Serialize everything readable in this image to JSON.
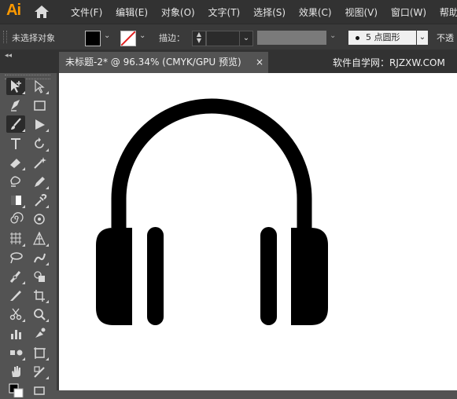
{
  "app": {
    "logo": "Ai"
  },
  "menus": [
    "文件(F)",
    "编辑(E)",
    "对象(O)",
    "文字(T)",
    "选择(S)",
    "效果(C)",
    "视图(V)",
    "窗口(W)",
    "帮助(H)"
  ],
  "control_bar": {
    "selection_label": "未选择对象",
    "stroke_label": "描边：",
    "brush_size": "5",
    "brush_label": "点圆形",
    "opacity_label": "不透"
  },
  "document": {
    "tab_title": "未标题-2* @ 96.34% (CMYK/GPU 预览)",
    "close_glyph": "×",
    "watermark": "软件自学网：RJZXW.COM"
  },
  "colors": {
    "fill": "#000000",
    "stroke": "none",
    "accent": "#ff9a00"
  },
  "tools": [
    [
      "selection-tool",
      "direct-selection-tool"
    ],
    [
      "pen-tool",
      "rectangle-tool"
    ],
    [
      "paintbrush-tool",
      "shaper-tool"
    ],
    [
      "type-tool",
      "rotate-tool"
    ],
    [
      "eraser-tool",
      "magic-wand-tool"
    ],
    [
      "blob-brush-tool",
      "pencil-tool"
    ],
    [
      "gradient-tool",
      "eyedropper-tool"
    ],
    [
      "spiral-tool",
      "symbol-sprayer-tool"
    ],
    [
      "mesh-tool",
      "perspective-grid-tool"
    ],
    [
      "lasso-tool",
      "puppet-warp-tool"
    ],
    [
      "width-tool",
      "shape-builder-tool"
    ],
    [
      "knife-tool",
      "crop-tool"
    ],
    [
      "scissors-tool",
      "zoom-tool"
    ],
    [
      "column-graph-tool",
      "live-paint-tool"
    ],
    [
      "blend-tool",
      "artboard-tool"
    ],
    [
      "hand-tool",
      "slice-tool"
    ],
    [
      "fill-stroke-swatch",
      "screen-mode"
    ]
  ]
}
